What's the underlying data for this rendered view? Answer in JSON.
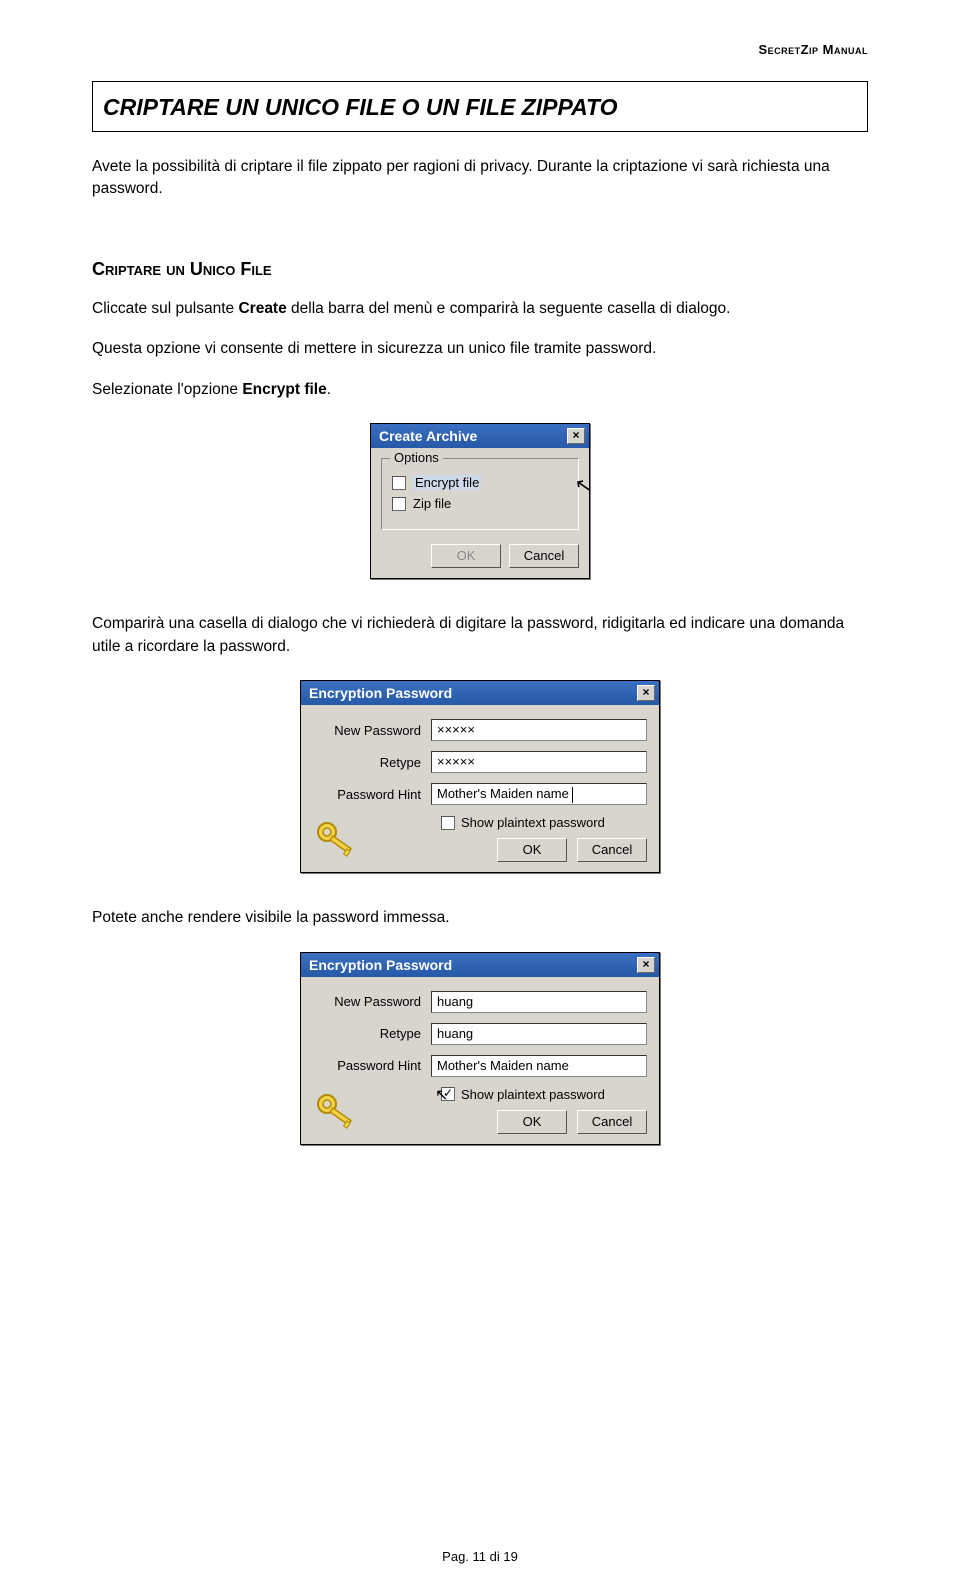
{
  "header_brand": "SecretZip Manual",
  "main_heading": "CRIPTARE UN UNICO FILE O UN FILE ZIPPATO",
  "intro_para": "Avete la possibilità di criptare il file zippato per ragioni di privacy.    Durante la criptazione vi sarà richiesta una password.",
  "subheading": "Criptare un Unico File",
  "para2_a": "Cliccate sul pulsante ",
  "para2_bold": "Create",
  "para2_b": " della barra del menù e comparirà la seguente casella di dialogo.",
  "para3": "Questa opzione vi consente di mettere in sicurezza un unico file tramite password.",
  "para4_a": "Selezionate l'opzione ",
  "para4_bold": "Encrypt file",
  "para4_b": ".",
  "dlg_create": {
    "title": "Create Archive",
    "legend": "Options",
    "opt1": "Encrypt file",
    "opt2": "Zip file",
    "ok": "OK",
    "cancel": "Cancel"
  },
  "para5": "Comparirà una casella di dialogo che vi richiederà di digitare la password, ridigitarla ed indicare una domanda utile a ricordare la password.",
  "dlg_ep": {
    "title": "Encryption Password",
    "new_pw": "New Password",
    "retype": "Retype",
    "hint": "Password Hint",
    "show": "Show plaintext password",
    "ok": "OK",
    "cancel": "Cancel"
  },
  "ep1": {
    "pw": "×××××",
    "retype": "×××××",
    "hint_val": "Mother's Maiden name",
    "show_checked": false
  },
  "para6": "Potete anche rendere visibile la password immessa.",
  "ep2": {
    "pw": "huang",
    "retype": "huang",
    "hint_val": "Mother's Maiden name",
    "show_checked": true
  },
  "footer": "Pag. 11 di 19"
}
